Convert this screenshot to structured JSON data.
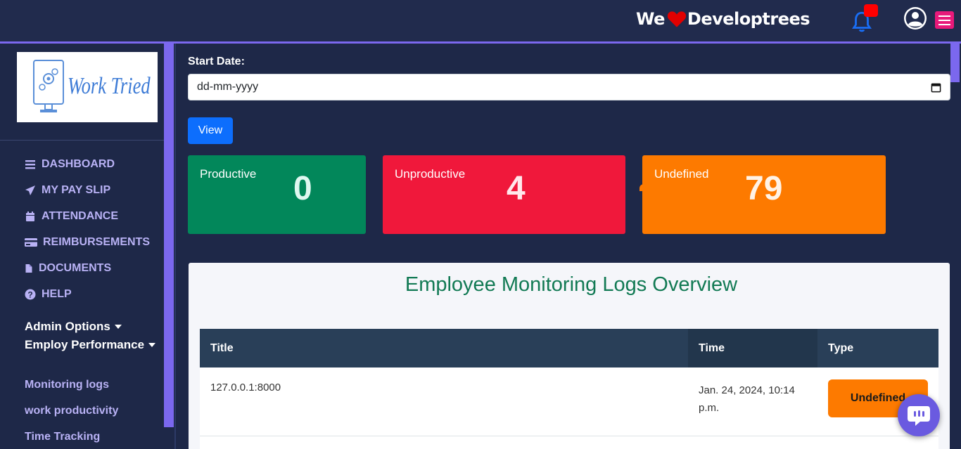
{
  "header": {
    "brand_left": "We",
    "brand_right": "Developtrees"
  },
  "sidebar": {
    "logo_text": "Work Tried",
    "nav": [
      {
        "label": "DASHBOARD",
        "icon": "bars-icon"
      },
      {
        "label": "MY PAY SLIP",
        "icon": "paper-plane-icon"
      },
      {
        "label": "ATTENDANCE",
        "icon": "calendar-icon"
      },
      {
        "label": "REIMBURSEMENTS",
        "icon": "credit-card-icon"
      },
      {
        "label": "DOCUMENTS",
        "icon": "file-icon"
      },
      {
        "label": "HELP",
        "icon": "question-circle-icon"
      }
    ],
    "admin_options": "Admin Options",
    "employ_performance": "Employ Performance",
    "sub_items": [
      "Monitoring logs",
      "work productivity",
      "Time Tracking"
    ]
  },
  "filter": {
    "start_label": "Start Date:",
    "date_placeholder": "dd-mm-yyyy",
    "view_label": "View"
  },
  "stats": {
    "productive": {
      "label": "Productive",
      "value": "0",
      "color": "#02875a"
    },
    "unproductive": {
      "label": "Unproductive",
      "value": "4",
      "color": "#f0183b"
    },
    "undefined": {
      "label": "Undefined",
      "value": "79",
      "color": "#fd7a00"
    }
  },
  "logs": {
    "title": "Employee Monitoring Logs Overview",
    "columns": [
      "Title",
      "Time",
      "Type"
    ],
    "rows": [
      {
        "title": "127.0.0.1:8000",
        "time": "Jan. 24, 2024, 10:14 p.m.",
        "type": "Undefined"
      }
    ]
  },
  "colors": {
    "background": "#1e2848",
    "accent": "#7b68ee",
    "button": "#0d6efd"
  }
}
